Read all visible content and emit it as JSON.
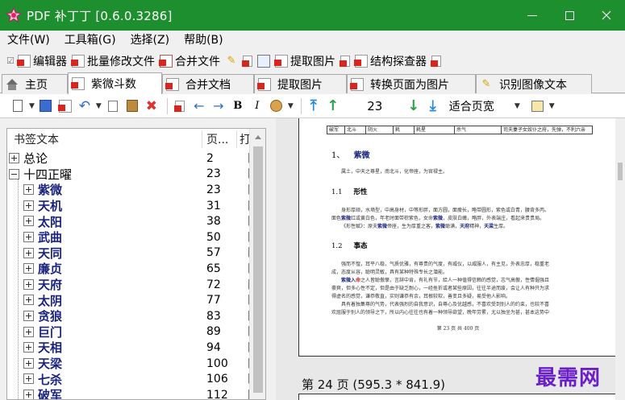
{
  "window": {
    "title": "PDF 补丁丁 [0.6.0.3286]",
    "colors": {
      "titlebar": "#1e8f2e",
      "accent": "#1a237e",
      "watermark": "#6b1fc9"
    }
  },
  "menu": [
    "文件(W)",
    "工具箱(G)",
    "选择(Z)",
    "帮助(B)"
  ],
  "toolbar1": [
    {
      "label": "编辑器",
      "icon": "pdf-edit-icon"
    },
    {
      "label": "批量修改文件",
      "icon": "pdf-batch-icon"
    },
    {
      "label": "合并文件",
      "icon": "merge-icon"
    },
    {
      "label": "",
      "icon": "key-icon"
    },
    {
      "label": "",
      "icon": "pdf-small-icon"
    },
    {
      "label": "",
      "icon": "doc-icon"
    },
    {
      "label": "提取图片",
      "icon": "pdf-image-icon"
    },
    {
      "label": "",
      "icon": "pdf-small-icon"
    },
    {
      "label": "结构探查器",
      "icon": "structure-icon"
    },
    {
      "label": "",
      "icon": "pdf-small-icon"
    }
  ],
  "tabs": [
    {
      "label": "主页",
      "icon": "home-icon",
      "active": false
    },
    {
      "label": "紫微斗数",
      "icon": "pdf-icon",
      "active": true
    },
    {
      "label": "合并文档",
      "icon": "pdf-icon",
      "active": false
    },
    {
      "label": "提取图片",
      "icon": "pdf-icon",
      "active": false
    },
    {
      "label": "转换页面为图片",
      "icon": "pdf-icon",
      "active": false
    },
    {
      "label": "识别图像文本",
      "icon": "key-icon",
      "active": false
    }
  ],
  "toolbar2": {
    "page_number": "23",
    "zoom": "适合页宽"
  },
  "bookmarks": {
    "headers": {
      "text": "书签文本",
      "page": "页...",
      "open": "打"
    },
    "rows": [
      {
        "text": "总论",
        "page": "2",
        "level": 0,
        "expand": "plus"
      },
      {
        "text": "十四正曜",
        "page": "23",
        "level": 0,
        "expand": "minus"
      },
      {
        "text": "紫微",
        "page": "23",
        "level": 1,
        "expand": "plus"
      },
      {
        "text": "天机",
        "page": "31",
        "level": 1,
        "expand": "plus"
      },
      {
        "text": "太阳",
        "page": "38",
        "level": 1,
        "expand": "plus"
      },
      {
        "text": "武曲",
        "page": "50",
        "level": 1,
        "expand": "plus"
      },
      {
        "text": "天同",
        "page": "57",
        "level": 1,
        "expand": "plus"
      },
      {
        "text": "廉贞",
        "page": "65",
        "level": 1,
        "expand": "plus"
      },
      {
        "text": "天府",
        "page": "72",
        "level": 1,
        "expand": "plus"
      },
      {
        "text": "太阴",
        "page": "77",
        "level": 1,
        "expand": "plus"
      },
      {
        "text": "贪狼",
        "page": "83",
        "level": 1,
        "expand": "plus"
      },
      {
        "text": "巨门",
        "page": "89",
        "level": 1,
        "expand": "plus"
      },
      {
        "text": "天相",
        "page": "94",
        "level": 1,
        "expand": "plus"
      },
      {
        "text": "天梁",
        "page": "100",
        "level": 1,
        "expand": "plus"
      },
      {
        "text": "七杀",
        "page": "106",
        "level": 1,
        "expand": "plus"
      },
      {
        "text": "破军",
        "page": "112",
        "level": 1,
        "expand": "plus"
      }
    ]
  },
  "preview": {
    "table_cells": [
      "破军",
      "北斗",
      "阴火",
      "耗",
      "耗星",
      "杀气",
      "司夫妻子女奴仆之府，先弹，不利六亲"
    ],
    "section_num": "1、",
    "section_title": "紫微",
    "intro": "属土，中天之尊星，南北斗，化帝座，为官禄主。",
    "sub1": "1.1",
    "sub1_title": "形性",
    "sub1_l1": "身形厚硕，水墒型，中高身材，中等形胖，面方圆，面瘦长，略带圆形，紫色或白青，腰背多丙。",
    "sub1_l2a": "面色",
    "sub1_l2b": "紫微",
    "sub1_l2c": "红或黄白色，年老时面带棕紫色，女命",
    "sub1_l2d": "紫微",
    "sub1_l2e": "，皮肤白嫩，略胖，外表端庄，看起来贵贵局。",
    "sub1_l3a": "《形性赋》：原夫",
    "sub1_l3b": "紫微",
    "sub1_l3c": "帝座，生为厚重之客，",
    "sub1_l3d": "紫微",
    "sub1_l3e": "聪满，",
    "sub1_l3f": "天府",
    "sub1_l3g": "精神，",
    "sub1_l3h": "天梁",
    "sub1_l3i": "生厚。",
    "sub2": "1.2",
    "sub2_title": "事态",
    "sub2_l1": "强而不惶，耳平八稳，气质优雅，有尊贵的气度，有威仪，以威服人，有主见，外表忠厚，稳重老",
    "sub2_l2": "成，态度从容，聪明灵敏，具有某种特殊专长之潜能。",
    "sub2_l3a": "紫微入",
    "sub2_l3b": "命",
    "sub2_l3c": "之人皆聪傲孳，言辞中肯，有礼有节，给人一种值得信赖的感觉，志气高傲，性情倔强且",
    "sub2_l4": "豪爽，但多心性不定，但是由于缺乏耐心，一经挫折或者某些原因，往往半途而废，会让人有种只为求",
    "sub2_l5": "得虚名的感觉，谦恭敬直，实则谦恭有余，耳根较软，善变且多疑，易受他人影响。",
    "sub2_l6": "具有着独集尊的气势，代表强烈的自我意识，自尊心及优越感，不喜欢受到别人的约束，也较不喜",
    "sub2_l7": "欢屈服于别人的领导之下，所以内心往往也有着一种领导欲望，晚年劳累，尤以独坐为甚，甚本这势中",
    "footer": "第 23 页 共 400 页",
    "next_caption": "第 24 页 (595.3 * 841.9)"
  },
  "watermark": "最需网"
}
